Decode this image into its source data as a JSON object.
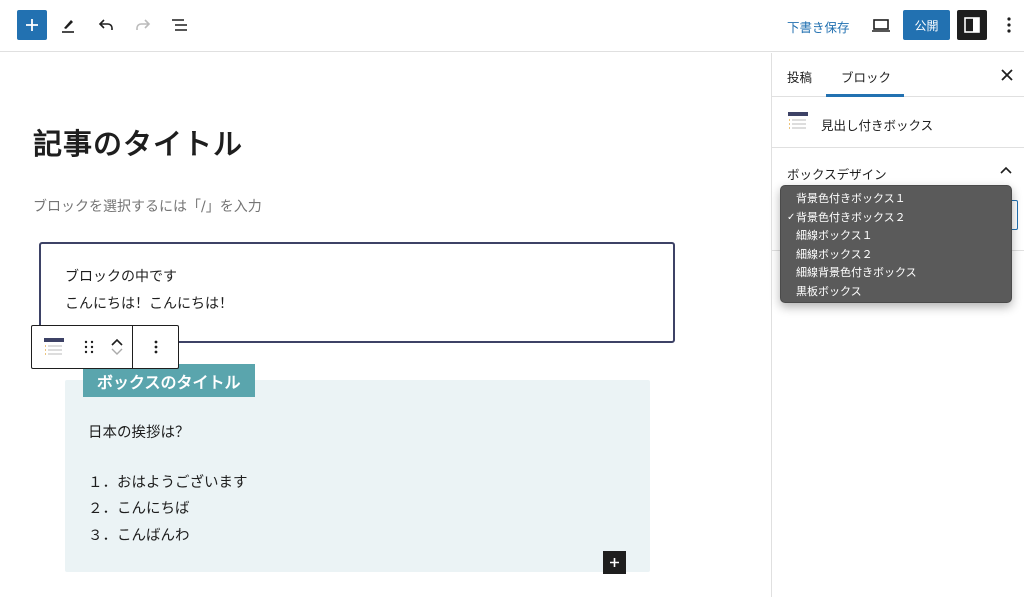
{
  "toolbar": {
    "icons": [
      "plus-icon",
      "pencil-icon",
      "undo-icon",
      "redo-icon",
      "list-view-icon",
      "desktop-preview-icon",
      "sidebar-settings-icon",
      "more-vertical-icon"
    ],
    "save_draft_label": "下書き保存",
    "publish_label": "公開"
  },
  "editor": {
    "post_title": "記事のタイトル",
    "placeholder": "ブロックを選択するには「/」を入力",
    "inner_block": {
      "line1": "ブロックの中です",
      "line2": "こんにちは！こんにちは！"
    },
    "heading_box": {
      "title": "ボックスのタイトル",
      "lines": [
        "日本の挨拶は？",
        "１．おはようございます",
        "２．こんにちば",
        "３．こんばんわ"
      ]
    }
  },
  "sidebar": {
    "tabs": [
      {
        "label": "投稿",
        "active": false
      },
      {
        "label": "ブロック",
        "active": true
      }
    ],
    "block_name": "見出し付きボックス",
    "panel_title": "ボックスデザイン",
    "dropdown_options": [
      {
        "label": "背景色付きボックス１",
        "selected": false
      },
      {
        "label": "背景色付きボックス２",
        "selected": true
      },
      {
        "label": "細線ボックス１",
        "selected": false
      },
      {
        "label": "細線ボックス２",
        "selected": false
      },
      {
        "label": "細線背景色付きボックス",
        "selected": false
      },
      {
        "label": "黒板ボックス",
        "selected": false
      }
    ],
    "check_mark": "✓"
  },
  "colors": {
    "accent": "#2271b1",
    "box_title_bg": "#5aa5ad",
    "box_bg": "#ebf3f5",
    "inner_border": "#3d4266",
    "dropdown_bg": "#5a5a5a"
  }
}
